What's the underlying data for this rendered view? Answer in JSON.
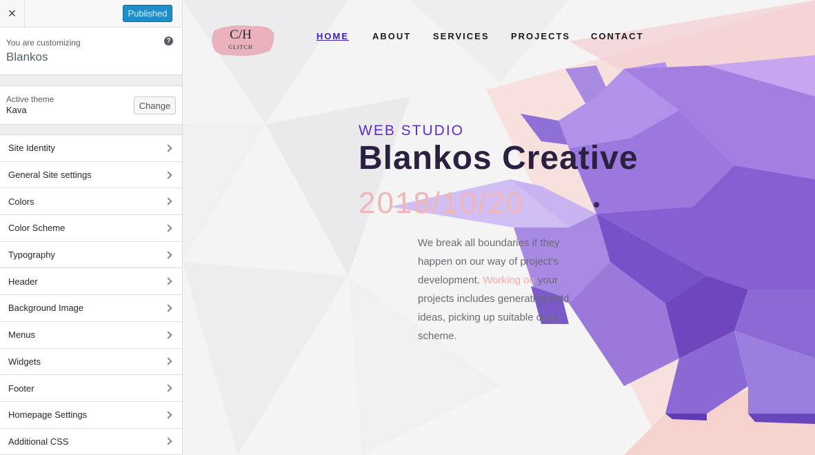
{
  "customizer": {
    "close_label": "×",
    "publish_label": "Published",
    "customizing_label": "You are customizing",
    "site_name": "Blankos",
    "help_label": "?",
    "active_theme_label": "Active theme",
    "theme_name": "Kava",
    "change_label": "Change",
    "sections": [
      {
        "label": "Site Identity"
      },
      {
        "label": "General Site settings"
      },
      {
        "label": "Colors"
      },
      {
        "label": "Color Scheme"
      },
      {
        "label": "Typography"
      },
      {
        "label": "Header"
      },
      {
        "label": "Background Image"
      },
      {
        "label": "Menus"
      },
      {
        "label": "Widgets"
      },
      {
        "label": "Footer"
      },
      {
        "label": "Homepage Settings"
      },
      {
        "label": "Additional CSS"
      }
    ]
  },
  "site": {
    "logo_main": "C/H",
    "logo_sub": "GLITCH",
    "nav": [
      {
        "label": "HOME",
        "active": true
      },
      {
        "label": "ABOUT"
      },
      {
        "label": "SERVICES"
      },
      {
        "label": "PROJECTS"
      },
      {
        "label": "CONTACT"
      }
    ],
    "hero": {
      "eyebrow": "WEB STUDIO",
      "title": "Blankos Creative",
      "date": "2018/10/20",
      "desc_part1": "We break all boundaries if they happen on our way of project's development.",
      "desc_accent": "Working on",
      "desc_part2": " your projects includes generating bold ideas, picking up suitable color scheme."
    }
  },
  "colors": {
    "publish_blue": "#1f8dc9",
    "nav_active": "#3a1fb8",
    "rhino_purple": "#9d7be0",
    "accent_pink": "#f2a9a9"
  },
  "icons": {
    "close": "close-icon",
    "help": "help-icon",
    "chevron": "chevron-right-icon"
  }
}
